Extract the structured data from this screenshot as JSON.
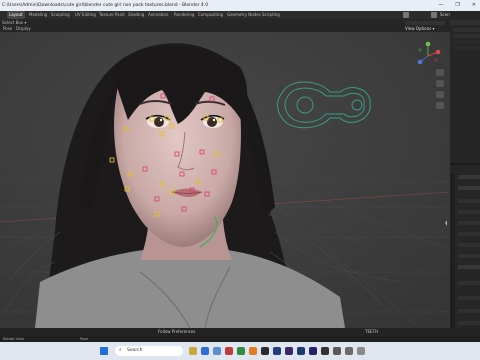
{
  "window": {
    "title": "C:\\Users\\Admin\\Downloads\\cute girl\\blender cute girl non pack textures.blend - Blender 4.0",
    "min": "—",
    "max": "❐",
    "close": "✕"
  },
  "tabs": [
    "Layout",
    "Modeling",
    "Sculpting",
    "UV Editing",
    "Texture Paint",
    "Shading",
    "Animation",
    "Rendering",
    "Compositing",
    "Geometry Nodes",
    "Scripting"
  ],
  "header": {
    "select_box": "Select Box ▾",
    "pose": "Pose",
    "display": "Display",
    "view_options": "View Options ▾",
    "scene": "Scene"
  },
  "viewport": {
    "outline_color": "#3a9c82",
    "label": "Follow Preferences"
  },
  "statusbar": {
    "text": "Follow Preferences",
    "teeth_label": "TEETH",
    "left2": "Rotate View",
    "right2": "Pose"
  },
  "taskbar": {
    "search_placeholder": "Search"
  }
}
